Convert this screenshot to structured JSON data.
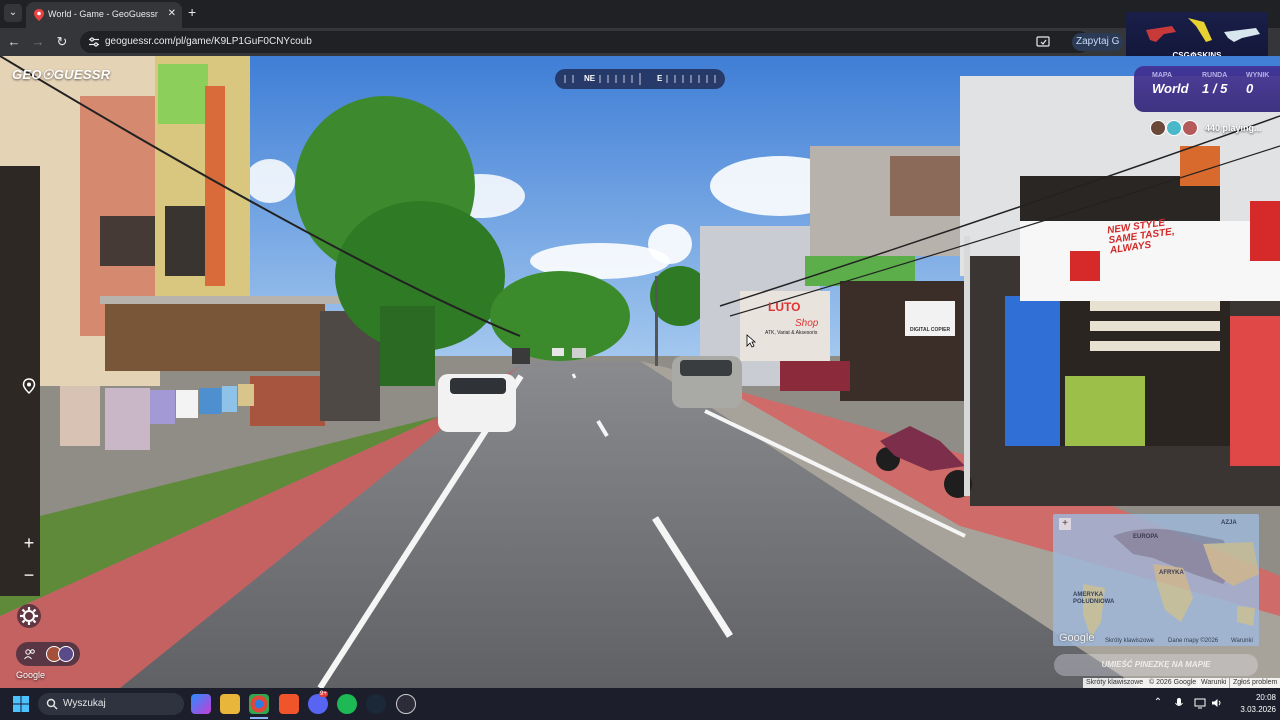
{
  "browser": {
    "tab_title": "World - Game - GeoGuessr",
    "url": "geoguessr.com/pl/game/K9LP1GuF0CNYcoub",
    "ask_button": "Zapytaj G",
    "ad_banner": "CSG⚙SKINS"
  },
  "game": {
    "logo": "GEO☉GUESSR",
    "compass": {
      "ne": "NE",
      "e": "E"
    },
    "status": {
      "map_label": "MAPA",
      "map_value": "World",
      "round_label": "RUNDA",
      "round_value": "1 / 5",
      "score_label": "WYNIK",
      "score_value": "0"
    },
    "players_text": "440 playing...",
    "controls": {
      "zoom_in": "+",
      "zoom_out": "−"
    },
    "google_watermark": "Google",
    "guess_button": "UMIEŚĆ PINEZKĘ NA MAPIE"
  },
  "minimap": {
    "labels": {
      "europe": "EUROPA",
      "asia": "AZJA",
      "africa": "AFRYKA",
      "south_america": "AMERYKA\nPOŁUDNIOWA"
    },
    "google": "Google",
    "footer": {
      "shortcuts": "Skróty klawiszowe",
      "map_data": "Dane mapy ©2026",
      "terms": "Warunki"
    }
  },
  "attribution": {
    "shortcuts": "Skróty klawiszowe",
    "copyright": "© 2026 Google",
    "terms": "Warunki",
    "report": "Zgłoś problem"
  },
  "signs": {
    "banner": "NEW STYLE\nSAME TASTE,\nALWAYS",
    "pluto": "LUTO",
    "shop": "Shop",
    "atk": "ATK, Variat & Aksesoris",
    "digital": "DIGITAL COPIER"
  },
  "taskbar": {
    "search_placeholder": "Wyszukaj",
    "time": "20:08",
    "date": "3.03.2026",
    "discord_badge": "9+"
  },
  "colors": {
    "accent": "#3d2f8f",
    "sky_top": "#4a86d8",
    "road": "#6e6f73",
    "curb": "#c9615e"
  }
}
